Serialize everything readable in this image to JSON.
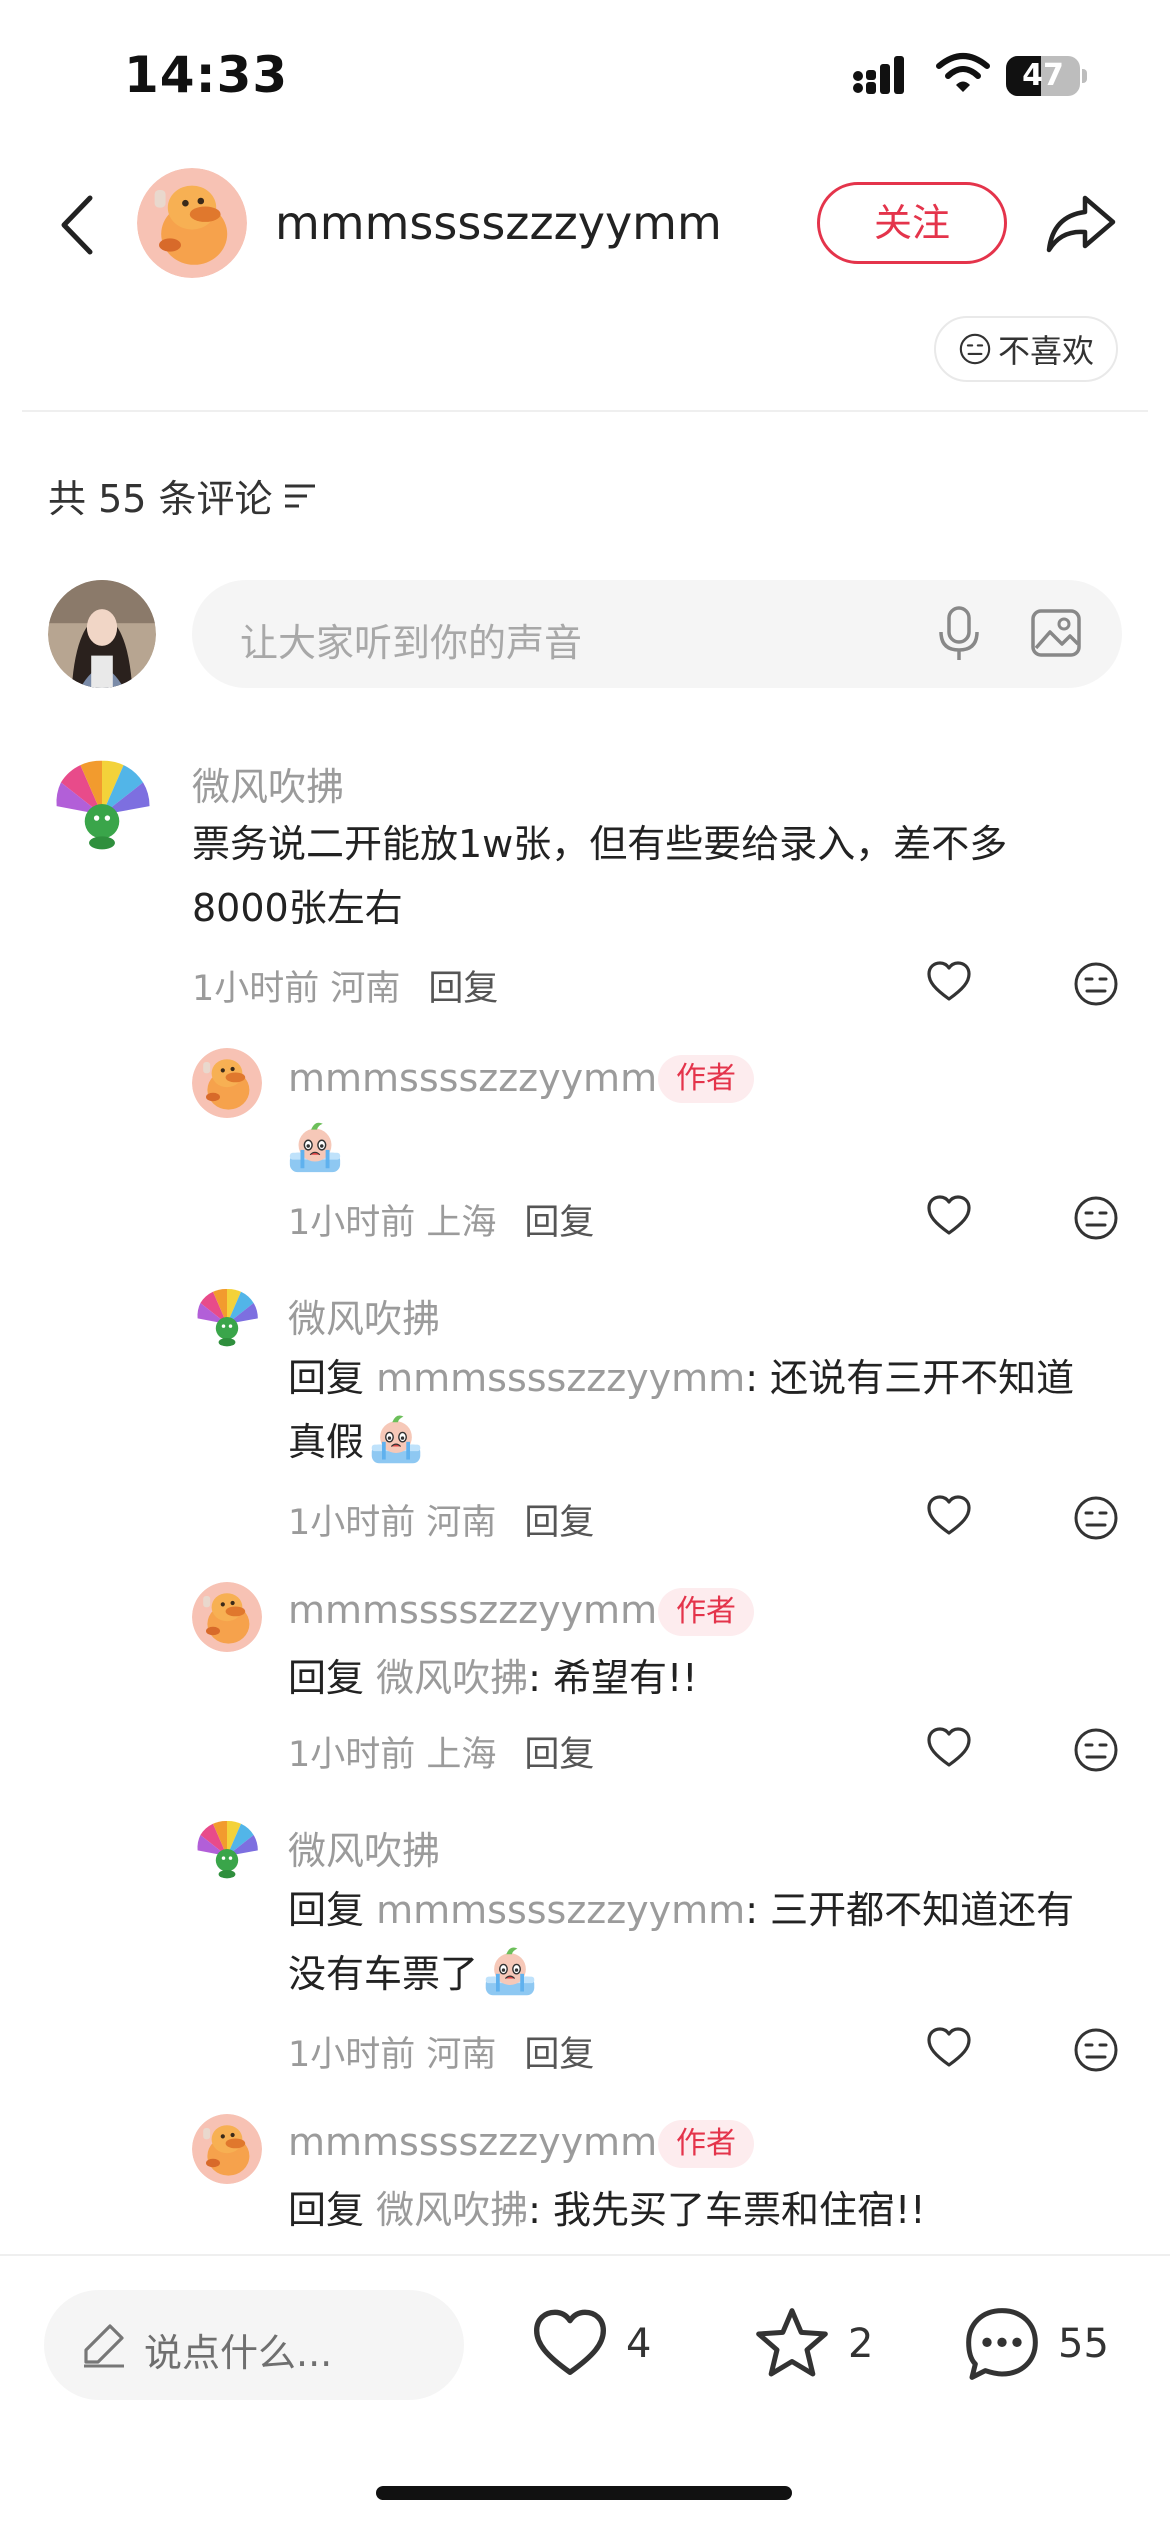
{
  "status_bar": {
    "time": "14:33",
    "battery": "47",
    "battery_level": 0.47
  },
  "header": {
    "username": "mmmsssszzzyymm",
    "follow_label": "关注",
    "dislike_label": "不喜欢"
  },
  "comments_header": {
    "label": "共 55 条评论"
  },
  "input": {
    "placeholder": "让大家听到你的声音"
  },
  "comments": [
    {
      "name": "微风吹拂",
      "text": "票务说二开能放1w张，但有些要给录入，差不多",
      "text2": "8000张左右",
      "meta": "1小时前 河南",
      "reply": "回复"
    },
    {
      "name": "mmmsssszzzyymm",
      "tag": "作者",
      "meta": "1小时前 上海",
      "reply": "回复"
    },
    {
      "name": "微风吹拂",
      "prefix": "回复 ",
      "target": "mmmsssszzzyymm",
      "text": ": 还说有三开不知道",
      "text2": "真假",
      "meta": "1小时前 河南",
      "reply": "回复"
    },
    {
      "name": "mmmsssszzzyymm",
      "tag": "作者",
      "prefix": "回复 ",
      "target": "微风吹拂",
      "text": ": 希望有!!",
      "meta": "1小时前 上海",
      "reply": "回复"
    },
    {
      "name": "微风吹拂",
      "prefix": "回复 ",
      "target": "mmmsssszzzyymm",
      "text": ": 三开都不知道还有",
      "text2": "没有车票了",
      "meta": "1小时前 河南",
      "reply": "回复"
    },
    {
      "name": "mmmsssszzzyymm",
      "tag": "作者",
      "prefix": "回复 ",
      "target": "微风吹拂",
      "text": ": 我先买了车票和住宿!!"
    }
  ],
  "bottom_bar": {
    "say_placeholder": "说点什么...",
    "likes": "4",
    "stars": "2",
    "comments": "55"
  },
  "colors": {
    "accent": "#e4344b",
    "muted": "#9b9b9b"
  },
  "icons": [
    "back-arrow-icon",
    "share-icon",
    "dislike-face-icon",
    "sort-icon",
    "mic-icon",
    "image-icon",
    "heart-icon",
    "neutral-face-icon",
    "pen-icon",
    "star-icon",
    "chat-bubble-icon",
    "crying-emoji"
  ]
}
